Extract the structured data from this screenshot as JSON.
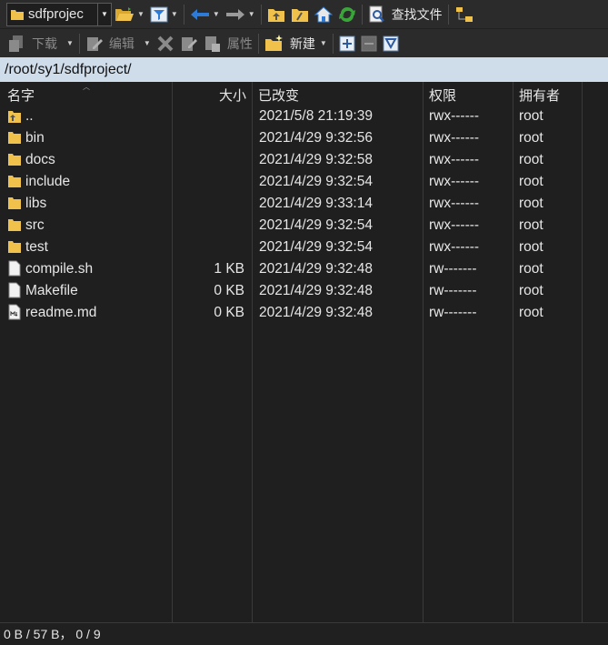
{
  "toolbar1": {
    "location_combo": "sdfprojec",
    "find_files_label": "查找文件"
  },
  "toolbar2": {
    "download_label": "下载",
    "edit_label": "编辑",
    "properties_label": "属性",
    "new_label": "新建"
  },
  "path": "/root/sy1/sdfproject/",
  "columns": {
    "name": "名字",
    "size": "大小",
    "changed": "已改变",
    "rights": "权限",
    "owner": "拥有者"
  },
  "files": [
    {
      "name": "..",
      "size": "",
      "changed": "2021/5/8 21:19:39",
      "rights": "rwx------",
      "owner": "root",
      "type": "parent-folder"
    },
    {
      "name": "bin",
      "size": "",
      "changed": "2021/4/29 9:32:56",
      "rights": "rwx------",
      "owner": "root",
      "type": "folder"
    },
    {
      "name": "docs",
      "size": "",
      "changed": "2021/4/29 9:32:58",
      "rights": "rwx------",
      "owner": "root",
      "type": "folder"
    },
    {
      "name": "include",
      "size": "",
      "changed": "2021/4/29 9:32:54",
      "rights": "rwx------",
      "owner": "root",
      "type": "folder"
    },
    {
      "name": "libs",
      "size": "",
      "changed": "2021/4/29 9:33:14",
      "rights": "rwx------",
      "owner": "root",
      "type": "folder"
    },
    {
      "name": "src",
      "size": "",
      "changed": "2021/4/29 9:32:54",
      "rights": "rwx------",
      "owner": "root",
      "type": "folder"
    },
    {
      "name": "test",
      "size": "",
      "changed": "2021/4/29 9:32:54",
      "rights": "rwx------",
      "owner": "root",
      "type": "folder"
    },
    {
      "name": "compile.sh",
      "size": "1 KB",
      "changed": "2021/4/29 9:32:48",
      "rights": "rw-------",
      "owner": "root",
      "type": "file"
    },
    {
      "name": "Makefile",
      "size": "0 KB",
      "changed": "2021/4/29 9:32:48",
      "rights": "rw-------",
      "owner": "root",
      "type": "file"
    },
    {
      "name": "readme.md",
      "size": "0 KB",
      "changed": "2021/4/29 9:32:48",
      "rights": "rw-------",
      "owner": "root",
      "type": "markdown-file"
    }
  ],
  "status": "0 B / 57 B， 0 / 9",
  "colors": {
    "background": "#1f1f1f",
    "toolbar": "#2b2b2b",
    "pathbar": "#cfdcea",
    "folder": "#f0c14b",
    "arrow_blue": "#2d7bd6",
    "refresh_green": "#3aa63a"
  }
}
